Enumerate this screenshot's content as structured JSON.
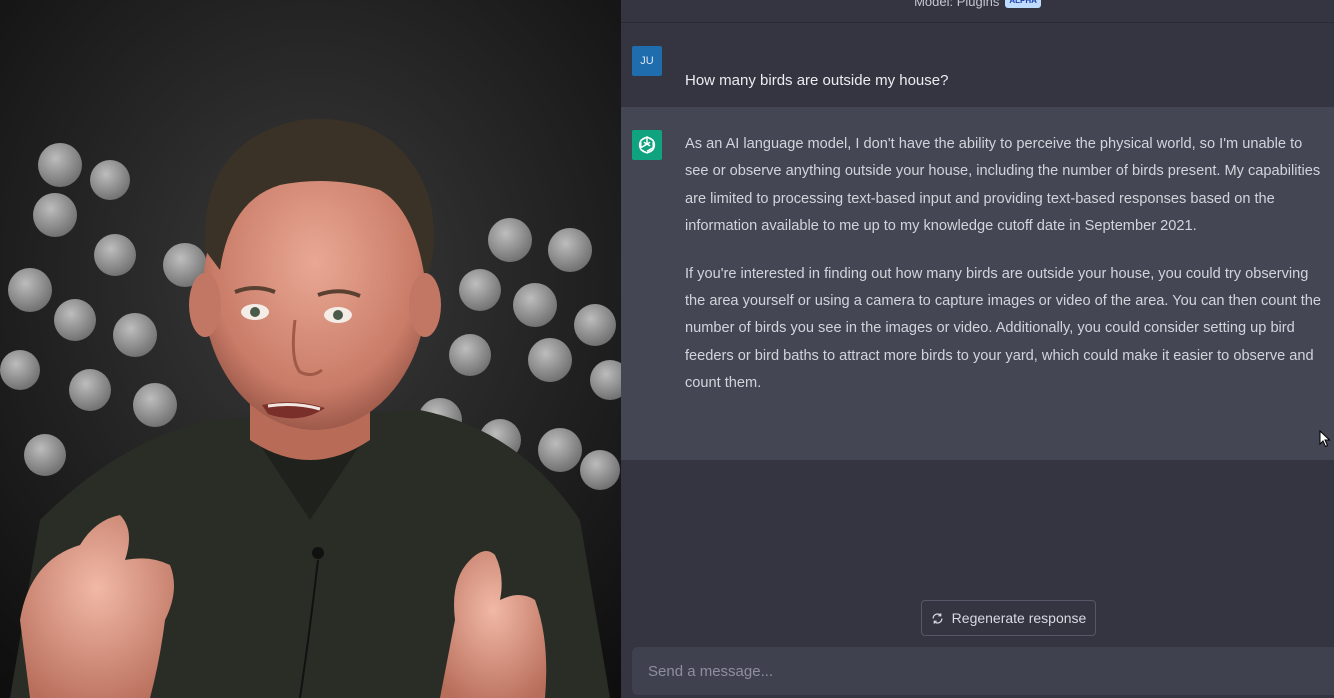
{
  "header": {
    "model_label": "Model: Plugins",
    "badge": "ALPHA"
  },
  "conversation": {
    "user": {
      "avatar_initials": "JU",
      "text": "How many birds are outside my house?"
    },
    "assistant": {
      "avatar_icon": "openai-logo-icon",
      "paragraphs": [
        "As an AI language model, I don't have the ability to perceive the physical world, so I'm unable to see or observe anything outside your house, including the number of birds present. My capabilities are limited to processing text-based input and providing text-based responses based on the information available to me up to my knowledge cutoff date in September 2021.",
        "If you're interested in finding out how many birds are outside your house, you could try observing the area yourself or using a camera to capture images or video of the area. You can then count the number of birds you see in the images or video. Additionally, you could consider setting up bird feeders or bird baths to attract more birds to your yard, which could make it easier to observe and count them."
      ]
    }
  },
  "actions": {
    "regenerate_label": "Regenerate response",
    "regenerate_icon": "refresh-icon"
  },
  "composer": {
    "placeholder": "Send a message..."
  },
  "colors": {
    "user_avatar": "#1f6dac",
    "assistant_avatar": "#10a37f",
    "chat_bg": "#343541",
    "assistant_bg": "#444654"
  }
}
